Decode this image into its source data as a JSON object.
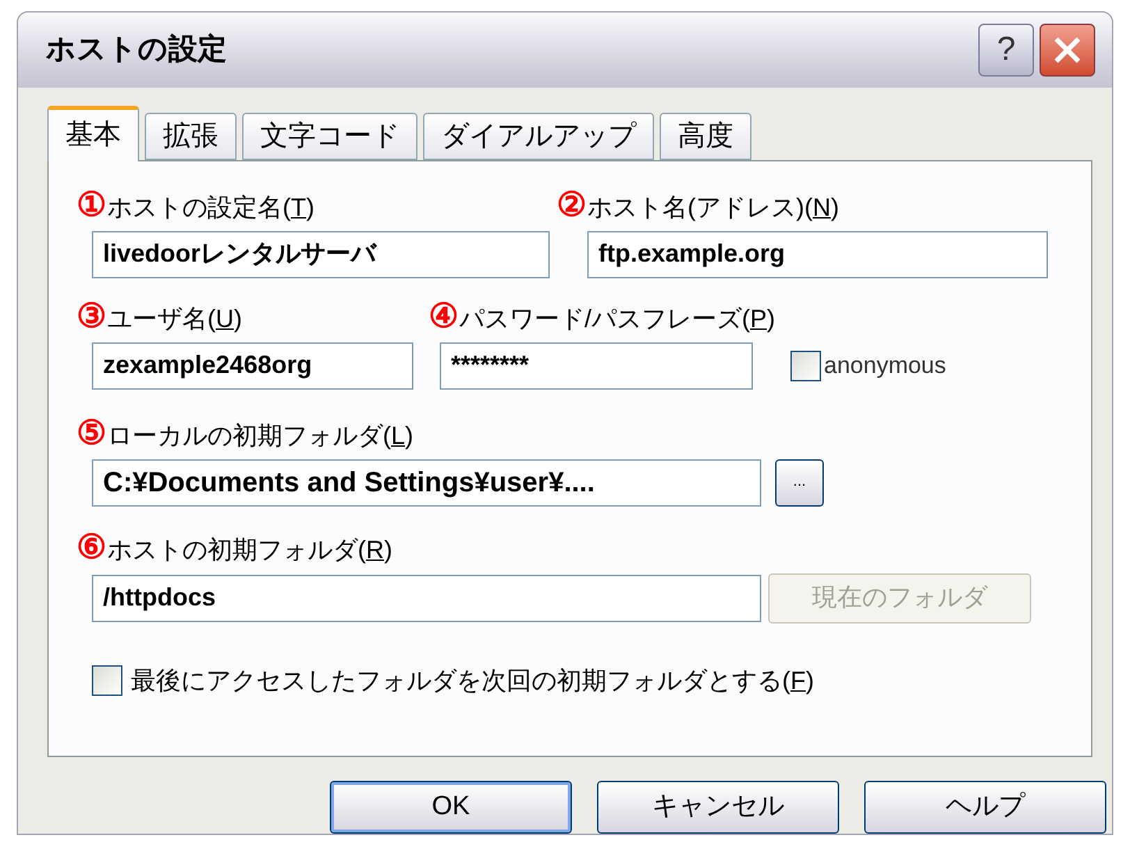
{
  "window": {
    "title": "ホストの設定",
    "help_button": "?"
  },
  "tabs": [
    {
      "label": "基本",
      "selected": true
    },
    {
      "label": "拡張",
      "selected": false
    },
    {
      "label": "文字コード",
      "selected": false
    },
    {
      "label": "ダイアルアップ",
      "selected": false
    },
    {
      "label": "高度",
      "selected": false
    }
  ],
  "host_setting_name": {
    "badge": "①",
    "label": "ホストの設定名(T)",
    "value": "livedoorレンタルサーバ"
  },
  "host_name": {
    "badge": "②",
    "label": "ホスト名(アドレス)(N)",
    "value": "ftp.example.org"
  },
  "user_name": {
    "badge": "③",
    "label": "ユーザ名(U)",
    "value": "zexample2468org"
  },
  "password": {
    "badge": "④",
    "label": "パスワード/パスフレーズ(P)",
    "value": "********"
  },
  "anonymous": {
    "label": "anonymous",
    "checked": false
  },
  "local_folder": {
    "badge": "⑤",
    "label": "ローカルの初期フォルダ(L)",
    "value": "C:¥Documents and Settings¥user¥....",
    "browse_button": "..."
  },
  "host_folder": {
    "badge": "⑥",
    "label": "ホストの初期フォルダ(R)",
    "value": "/httpdocs",
    "current_button": {
      "label": "現在のフォルダ",
      "disabled": true
    }
  },
  "last_folder": {
    "label": "最後にアクセスしたフォルダを次回の初期フォルダとする(F)",
    "checked": false
  },
  "buttons": [
    {
      "label": "OK",
      "default": true
    },
    {
      "label": "キャンセル",
      "default": false
    },
    {
      "label": "ヘルプ",
      "default": false
    }
  ]
}
